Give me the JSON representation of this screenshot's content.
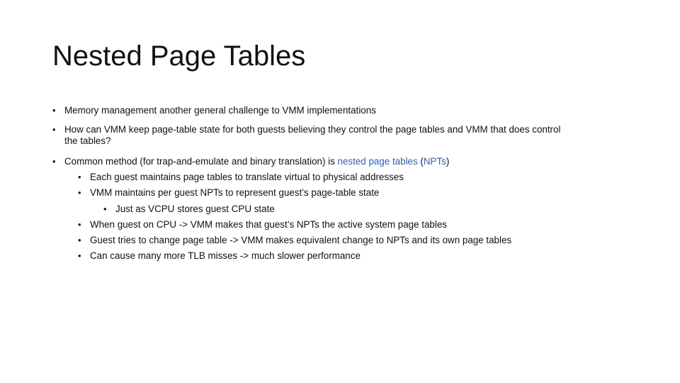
{
  "slide": {
    "title": "Nested Page Tables",
    "bullets": [
      {
        "level": 1,
        "text": "Memory management another general challenge to VMM implementations"
      },
      {
        "level": 1,
        "text_line1": "How can VMM keep page-table state for both guests believing they control the page tables and VMM that does control",
        "text_line2": "the tables?"
      },
      {
        "level": 1,
        "text_before": "Common method (for trap-and-emulate and binary translation) is ",
        "link_text": "nested page tables",
        "text_mid": " (",
        "abbr_text": "NPTs",
        "text_after": ")"
      },
      {
        "level": 2,
        "text": "Each guest maintains page tables to translate virtual to physical addresses"
      },
      {
        "level": 2,
        "text": "VMM maintains per guest NPTs to represent guest’s page-table state"
      },
      {
        "level": 3,
        "text": "Just as VCPU stores guest CPU state"
      },
      {
        "level": 2,
        "text": "When guest on CPU -> VMM makes that guest’s NPTs the active system page tables"
      },
      {
        "level": 2,
        "text": "Guest tries to change page table -> VMM makes equivalent change to NPTs and its own page tables"
      },
      {
        "level": 2,
        "text": "Can cause many more TLB misses -> much slower performance"
      }
    ],
    "bullet_glyph": "•",
    "colors": {
      "text": "#111111",
      "link": "#2e5fae",
      "background": "#ffffff"
    }
  }
}
